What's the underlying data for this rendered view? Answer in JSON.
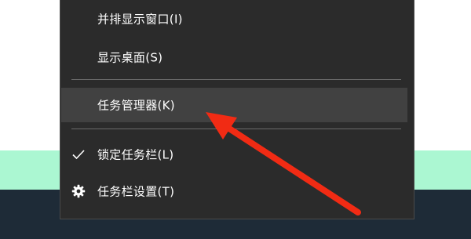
{
  "menu": {
    "items": [
      {
        "label": "并排显示窗口(I)"
      },
      {
        "label": "显示桌面(S)"
      },
      {
        "label": "任务管理器(K)"
      },
      {
        "label": "锁定任务栏(L)"
      },
      {
        "label": "任务栏设置(T)"
      }
    ]
  },
  "icons": {
    "checkmark": "check-icon",
    "settings": "gear-icon",
    "annotation": "red-arrow-icon"
  },
  "colors": {
    "menu_bg": "#2b2b2b",
    "hover_bg": "#414141",
    "text": "#ffffff",
    "arrow": "#f12b14",
    "mint_strip": "#abf7d2",
    "taskbar": "#1e2b37"
  }
}
